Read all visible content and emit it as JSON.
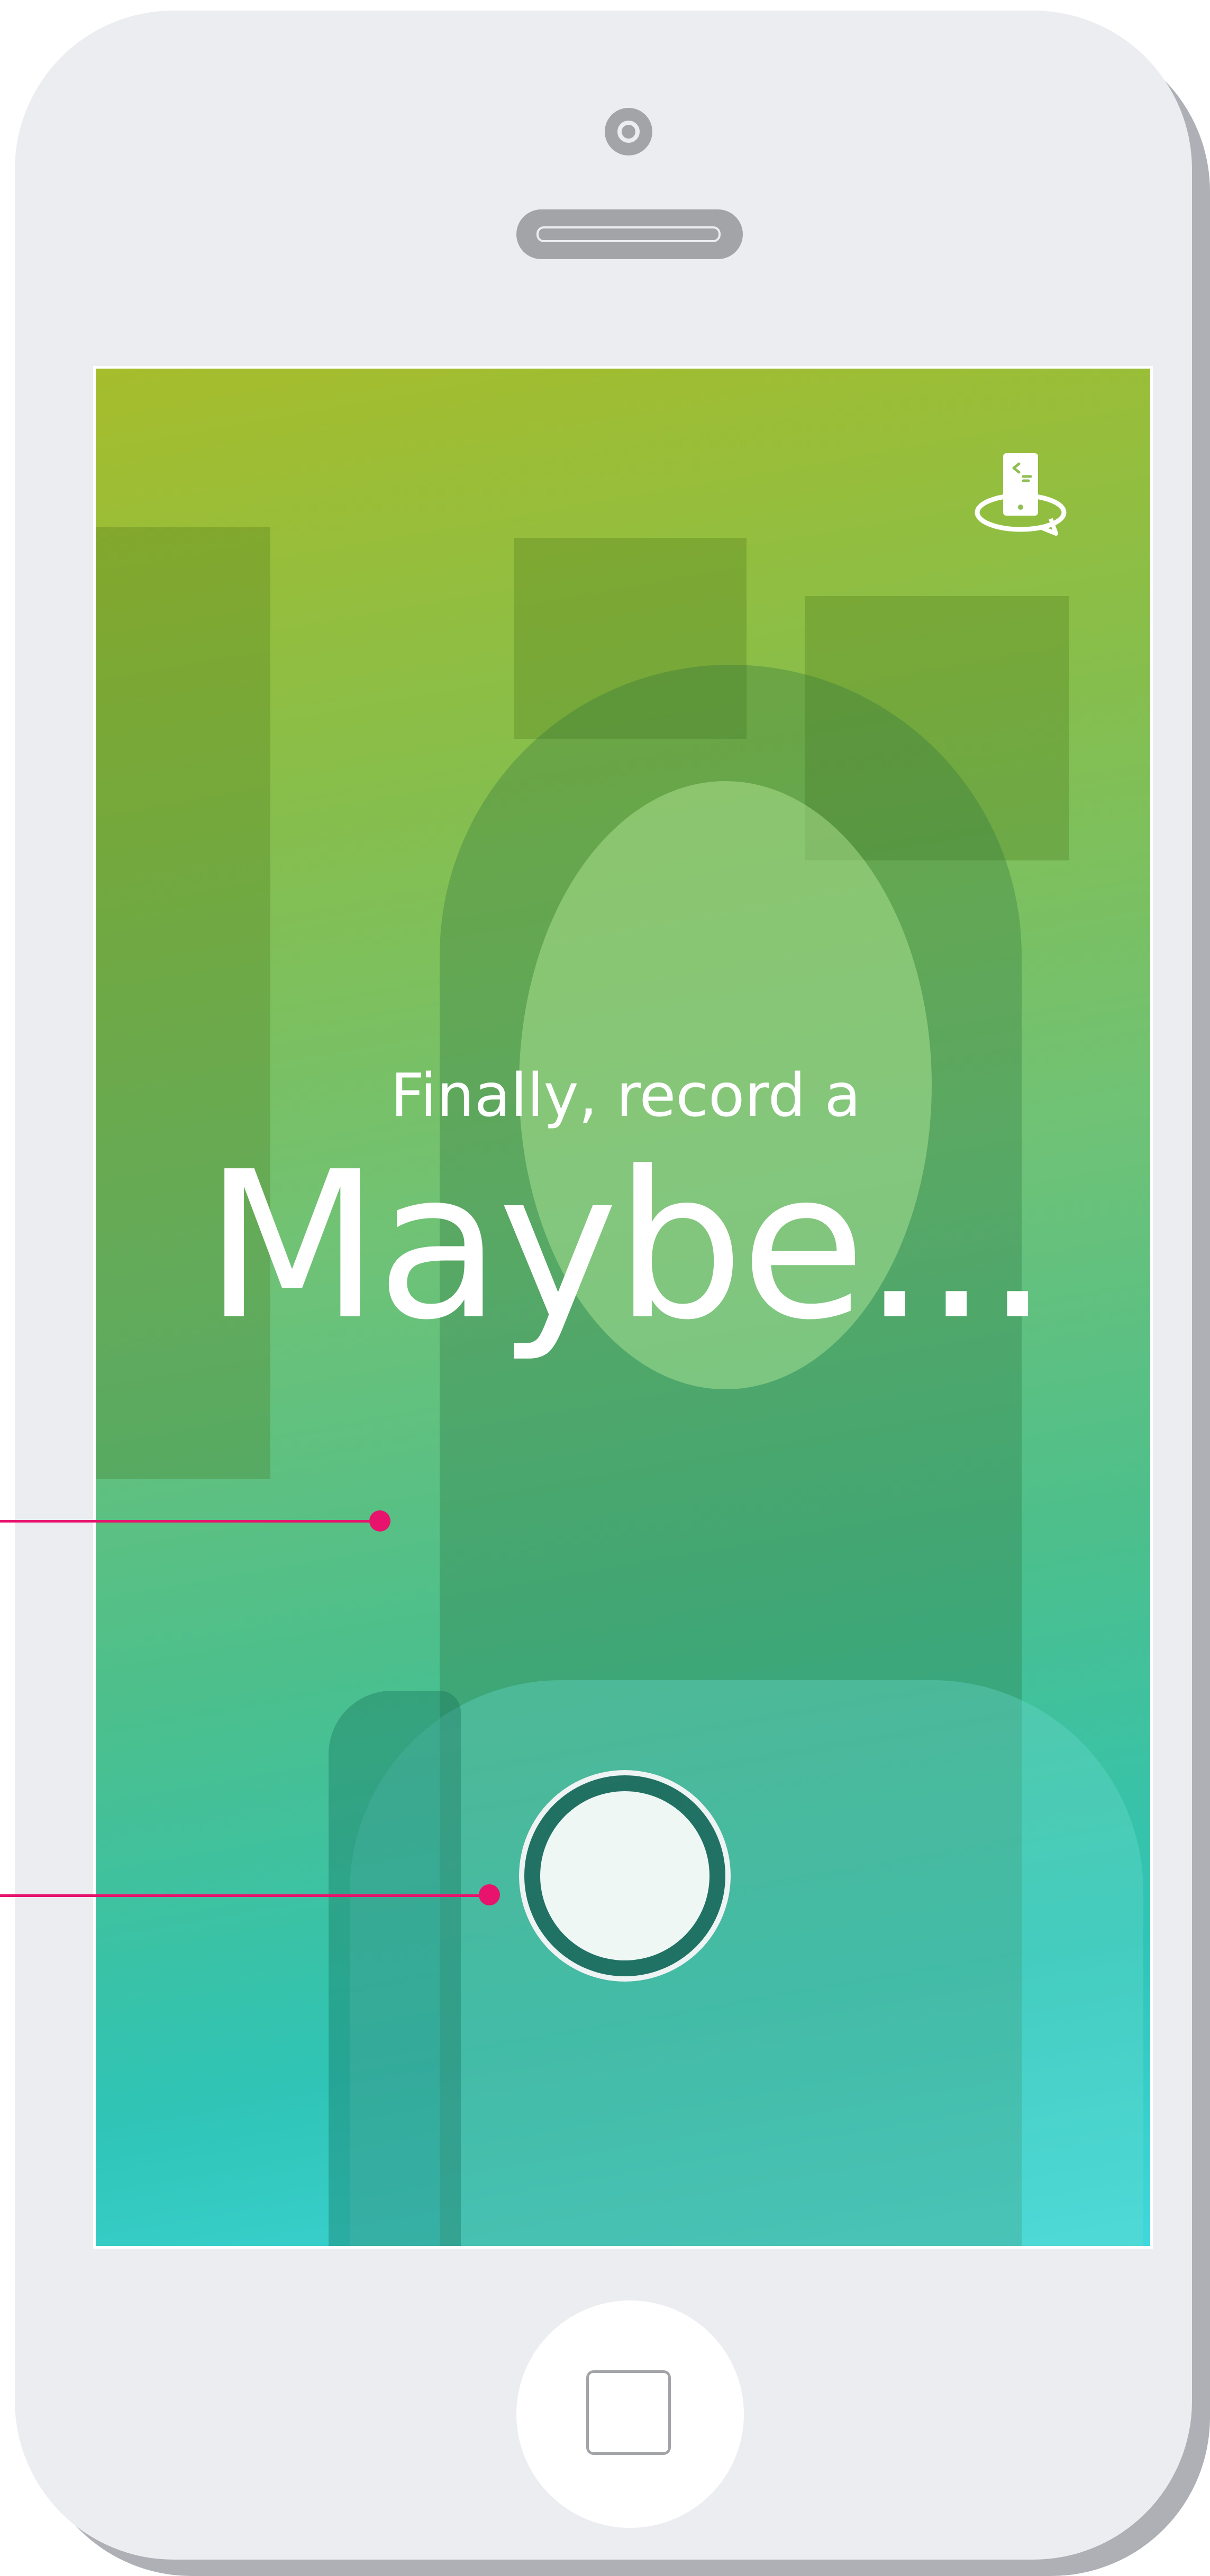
{
  "screen": {
    "subtitle": "Finally, record a",
    "headline": "Maybe..."
  },
  "icons": {
    "front_camera": "camera-dot",
    "earpiece": "speaker-slot",
    "camera_switch": "rotate-camera-icon",
    "record": "record-circle",
    "home": "home-square"
  },
  "colors": {
    "callout_accent": "#e8136d",
    "gradient_top": "#a6bd2c",
    "gradient_bottom": "#3fd8dc",
    "device_body": "#ecedf1"
  }
}
